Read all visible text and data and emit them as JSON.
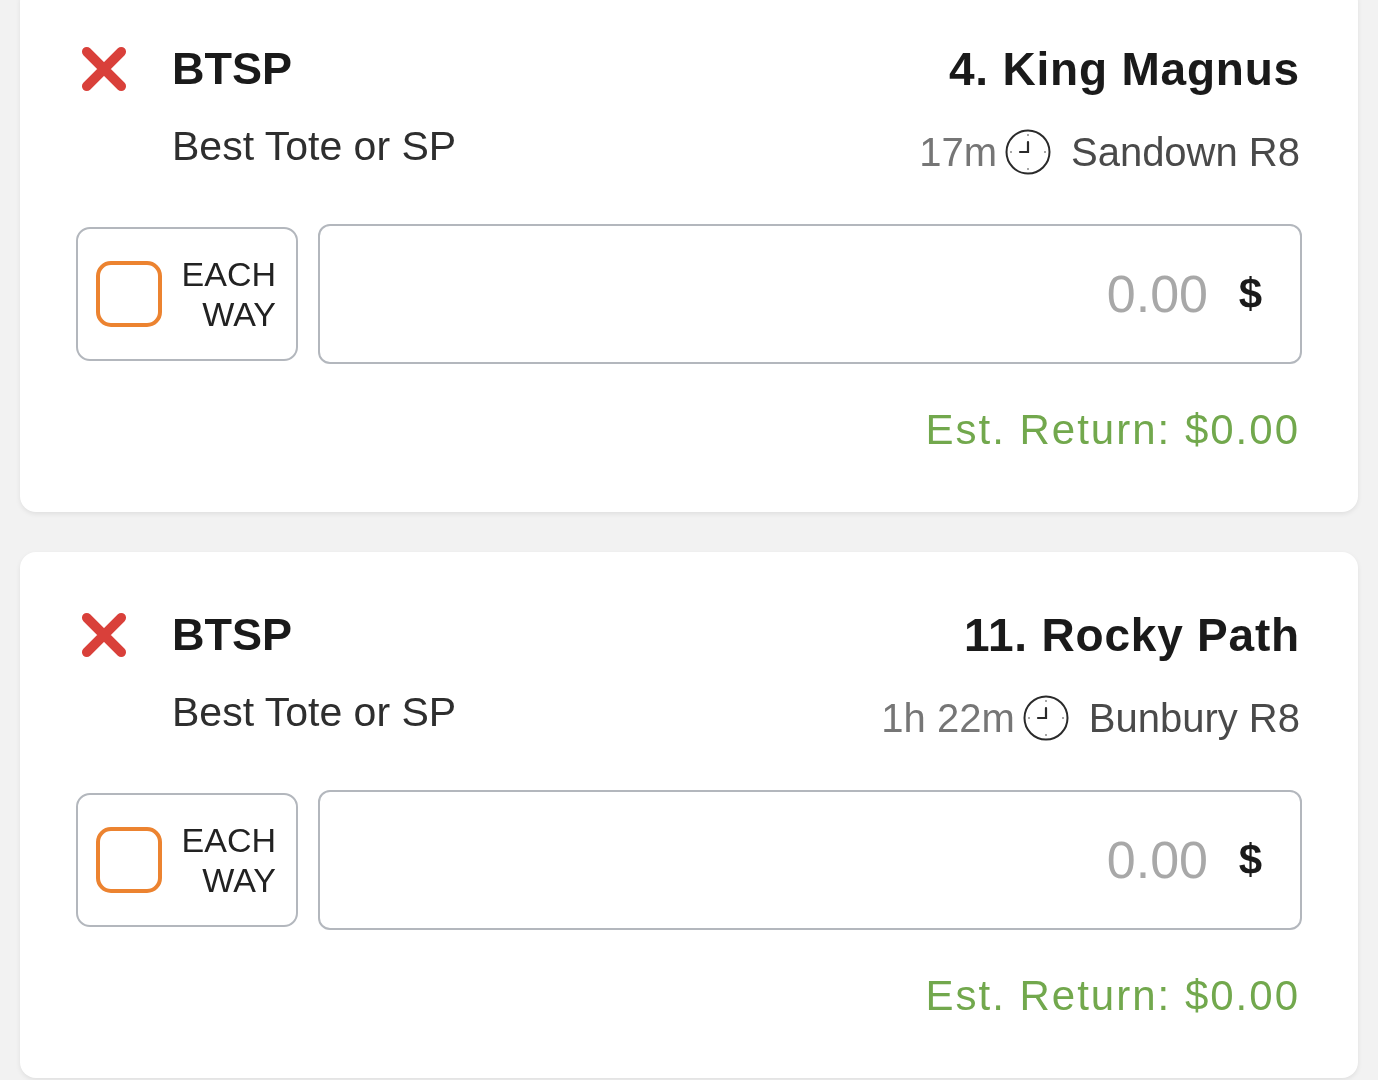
{
  "bets": [
    {
      "runner": "4. King Magnus",
      "venue": "Sandown R8",
      "time": "17m",
      "bet_type": "BTSP",
      "bet_type_desc": "Best Tote or SP",
      "stake": {
        "currency": "$",
        "placeholder": "0.00"
      },
      "each_way": {
        "label": "EACH WAY",
        "checked": false
      },
      "est_return": "Est. Return: $0.00"
    },
    {
      "runner": "11. Rocky Path",
      "venue": "Bunbury R8",
      "time": "1h 22m",
      "bet_type": "BTSP",
      "bet_type_desc": "Best Tote or SP",
      "stake": {
        "currency": "$",
        "placeholder": "0.00"
      },
      "each_way": {
        "label": "EACH WAY",
        "checked": false
      },
      "est_return": "Est. Return: $0.00"
    }
  ]
}
